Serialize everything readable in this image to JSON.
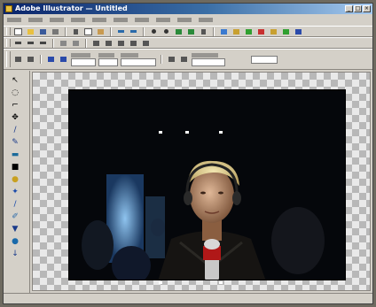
{
  "window": {
    "title": "Adobe Illustrator — Untitled"
  },
  "status": {
    "text": ""
  },
  "colors": {
    "title_start": "#0a246a",
    "title_end": "#a6caf0",
    "chrome": "#d4d0c8",
    "canvas_check": "#b8b8b8"
  },
  "icons": {
    "toolbar1": [
      "new-file-icon",
      "open-icon",
      "save-icon",
      "print-icon",
      "cut-icon",
      "copy-icon",
      "paste-icon",
      "undo-icon",
      "redo-icon",
      "zoom-in-icon",
      "zoom-out-icon",
      "rotate-icon",
      "flip-icon",
      "crop-icon",
      "resize-icon",
      "image-icon",
      "color-icon",
      "help-icon"
    ],
    "tools": [
      "select-icon",
      "lasso-icon",
      "crop-tool-icon",
      "move-icon",
      "brush-icon",
      "pencil-icon",
      "eraser-icon",
      "fill-icon",
      "text-icon",
      "clone-icon",
      "smudge-icon",
      "eyedropper-icon",
      "shape-icon",
      "hand-icon",
      "zoom-tool-icon"
    ]
  }
}
